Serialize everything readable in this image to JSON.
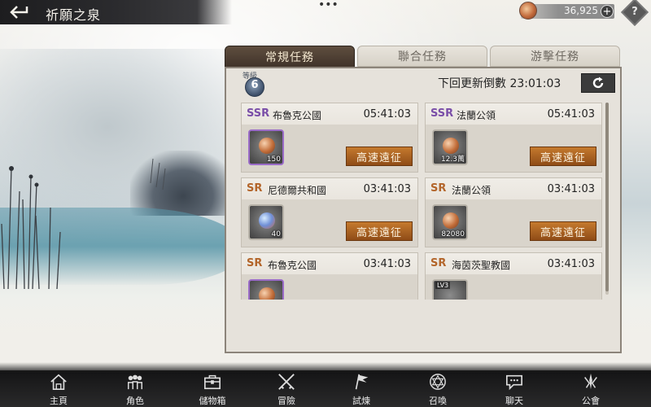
{
  "header": {
    "back_icon": "back-arrow-icon",
    "title": "祈願之泉",
    "more_icon": "more-dots-icon",
    "currency": {
      "icon": "coin-icon",
      "value": "36,925",
      "plus": "+"
    },
    "help_icon": "help-diamond-icon"
  },
  "tabs": [
    {
      "label": "常規任務",
      "active": true
    },
    {
      "label": "聯合任務",
      "active": false
    },
    {
      "label": "游擊任務",
      "active": false
    }
  ],
  "level": {
    "label": "等級",
    "value": "6"
  },
  "refresh": {
    "label": "下回更新倒數 23:01:03",
    "icon": "refresh-icon"
  },
  "quests": [
    {
      "rarity": "SSR",
      "name": "布魯克公國",
      "time": "05:41:03",
      "item_count": "150",
      "item_tag": "",
      "button": "高速遠征"
    },
    {
      "rarity": "SSR",
      "name": "法蘭公領",
      "time": "05:41:03",
      "item_count": "12.3萬",
      "item_tag": "",
      "button": "高速遠征"
    },
    {
      "rarity": "SR",
      "name": "尼德爾共和國",
      "time": "03:41:03",
      "item_count": "40",
      "item_tag": "",
      "button": "高速遠征"
    },
    {
      "rarity": "SR",
      "name": "法蘭公領",
      "time": "03:41:03",
      "item_count": "82080",
      "item_tag": "",
      "button": "高速遠征"
    },
    {
      "rarity": "SR",
      "name": "布魯克公國",
      "time": "03:41:03",
      "item_count": "",
      "item_tag": "",
      "button": ""
    },
    {
      "rarity": "SR",
      "name": "海茵茨聖教國",
      "time": "03:41:03",
      "item_count": "",
      "item_tag": "LV3",
      "button": ""
    }
  ],
  "nav": [
    {
      "label": "主頁",
      "icon": "home-icon"
    },
    {
      "label": "角色",
      "icon": "characters-icon"
    },
    {
      "label": "儲物箱",
      "icon": "storage-chest-icon"
    },
    {
      "label": "冒險",
      "icon": "crossed-swords-icon"
    },
    {
      "label": "試煉",
      "icon": "trial-flag-icon"
    },
    {
      "label": "召喚",
      "icon": "summon-icon"
    },
    {
      "label": "聊天",
      "icon": "chat-icon"
    },
    {
      "label": "公會",
      "icon": "guild-icon"
    }
  ]
}
